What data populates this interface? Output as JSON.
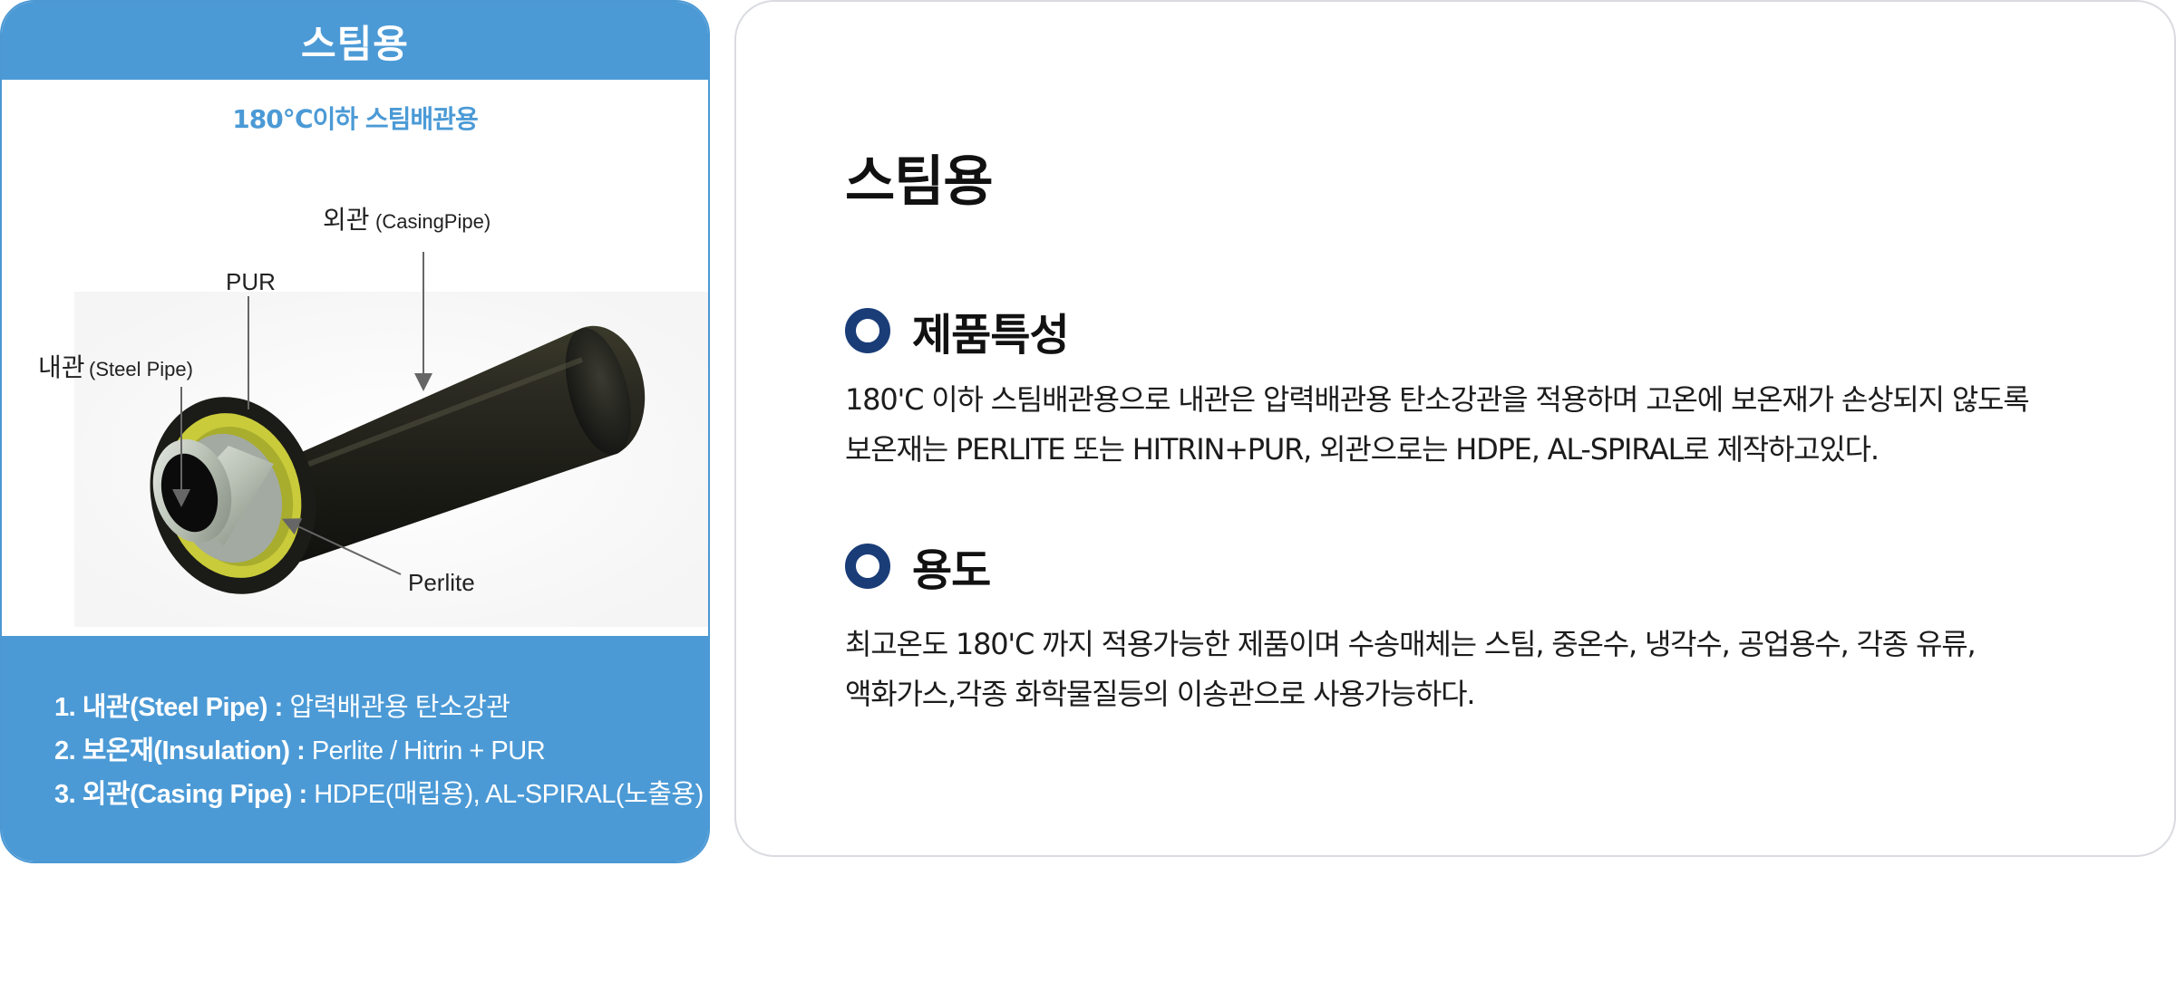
{
  "card": {
    "header_title": "스팀용",
    "subtitle": "180℃이하 스팀배관용",
    "figure_labels": {
      "casing": "외관",
      "casing_en": "(CasingPipe)",
      "pur": "PUR",
      "inner": "내관",
      "inner_en": "(Steel Pipe)",
      "perlite": "Perlite"
    },
    "specs": [
      {
        "key": "1. 내관(Steel Pipe) : ",
        "value": "압력배관용 탄소강관"
      },
      {
        "key": "2. 보온재(Insulation) : ",
        "value": "Perlite / Hitrin + PUR"
      },
      {
        "key": "3. 외관(Casing Pipe) : ",
        "value": "HDPE(매립용), AL-SPIRAL(노출용)"
      }
    ]
  },
  "panel": {
    "title": "스팀용",
    "sections": [
      {
        "heading": "제품특성",
        "lines": [
          "180'C 이하 스팀배관용으로 내관은 압력배관용 탄소강관을 적용하며 고온에 보온재가 손상되지 않도록",
          "보온재는 PERLITE 또는 HITRIN+PUR,  외관으로는 HDPE, AL-SPIRAL로 제작하고있다."
        ]
      },
      {
        "heading": "용도",
        "lines": [
          "최고온도 180'C 까지 적용가능한 제품이며  수송매체는 스팀, 중온수, 냉각수, 공업용수, 각종 유류,",
          "액화가스,각종 화학물질등의 이송관으로 사용가능하다."
        ]
      }
    ]
  },
  "colors": {
    "card_blue": "#4b9ad6",
    "bullet_navy": "#1a3d78",
    "panel_border": "#d9dbe0"
  }
}
